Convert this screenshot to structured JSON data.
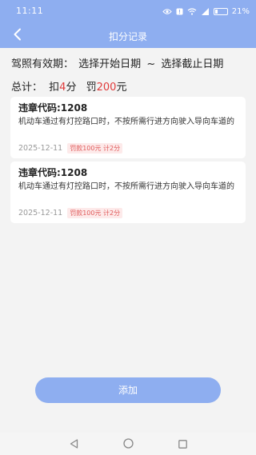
{
  "status_bar": {
    "time": "11:11",
    "battery_percent": 21,
    "battery_label": "21%",
    "icons": [
      "eye-icon",
      "notification-icon",
      "wifi-icon",
      "signal-icon",
      "battery-icon"
    ]
  },
  "header": {
    "title": "扣分记录",
    "back_icon": "chevron-left-icon"
  },
  "filter": {
    "validity_label": "驾照有效期：",
    "start_placeholder": "选择开始日期",
    "separator": "~",
    "end_placeholder": "选择截止日期"
  },
  "summary": {
    "total_label": "总计：",
    "points_prefix": "扣",
    "points_value": "4",
    "points_unit": "分",
    "fine_prefix": "罚",
    "fine_value": "200",
    "fine_unit": "元"
  },
  "records": [
    {
      "title": "违章代码:1208",
      "description": "机动车通过有灯控路口时，不按所需行进方向驶入导向车道的",
      "date": "2025-12-11",
      "penalty": "罚款100元 计2分"
    },
    {
      "title": "违章代码:1208",
      "description": "机动车通过有灯控路口时，不按所需行进方向驶入导向车道的",
      "date": "2025-12-11",
      "penalty": "罚款100元 计2分"
    }
  ],
  "add_button": {
    "label": "添加"
  },
  "colors": {
    "primary": "#8eaef0",
    "accent_red": "#e03a3a",
    "background": "#f3f3f3",
    "card": "#ffffff"
  }
}
